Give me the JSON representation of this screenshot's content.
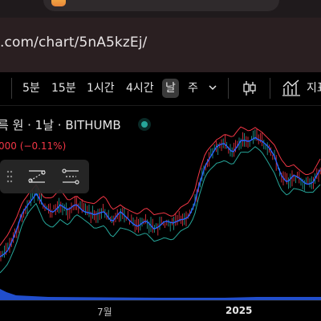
{
  "browser": {
    "url": ".com/chart/5nA5kzEj/"
  },
  "toolbar": {
    "timeframes": [
      "5분",
      "15분",
      "1시간",
      "4시간",
      "날",
      "주"
    ],
    "active_timeframe": "날",
    "indicators_label": "지표"
  },
  "legend": {
    "title": "륵 원 · 1날 · BITHUMB",
    "price_change": "000 (−0.11%)"
  },
  "x_axis": {
    "labels": [
      "7월",
      "2025"
    ]
  },
  "colors": {
    "background": "#000000",
    "price_line": "#2962ff",
    "upper_band": "#f23645",
    "lower_band": "#26a69a",
    "candle_up": "#26a69a",
    "candle_down": "#f23645",
    "volume": "#2962ff",
    "live_dot": "#26a69a"
  },
  "icons": {
    "timeframe_dropdown": "chevron-down-icon",
    "chart_type": "candlestick-icon",
    "indicators": "indicators-icon",
    "drag": "drag-handle-icon",
    "tool_1": "trend-line-tool-icon",
    "tool_2": "horizontal-lines-tool-icon",
    "live": "live-status-icon"
  }
}
